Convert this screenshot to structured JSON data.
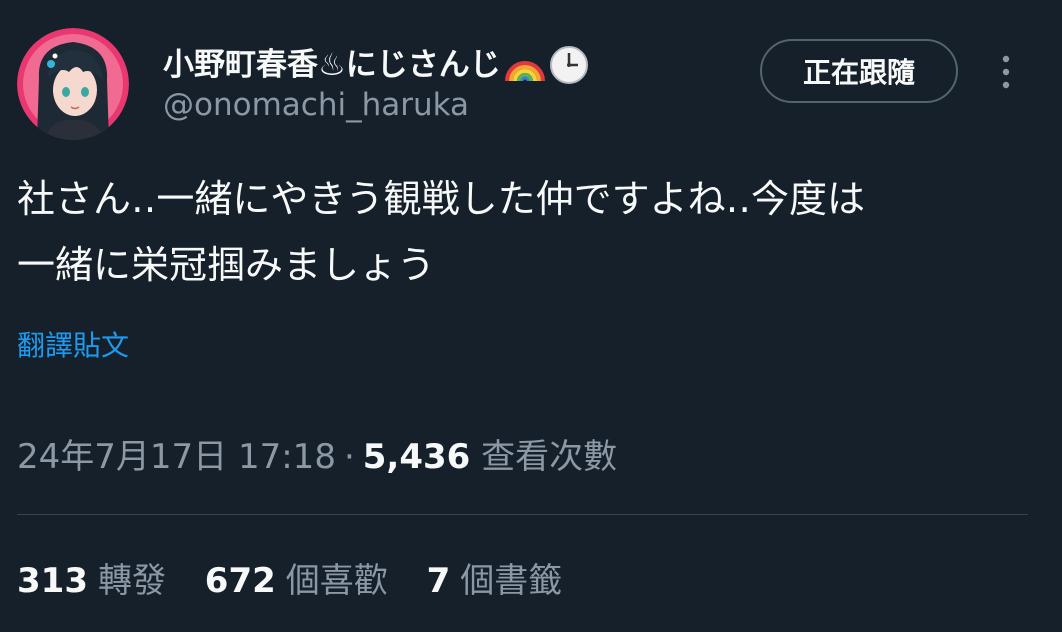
{
  "author": {
    "display_name": "小野町春香♨にじさんじ",
    "handle": "@onomachi_haruka",
    "avatar_icon": "avatar-anime-girl",
    "badge_icons": [
      "rainbow-emoji-icon",
      "clock-emoji-icon"
    ]
  },
  "header": {
    "follow_label": "正在跟隨",
    "more_icon": "more-vertical-icon"
  },
  "tweet": {
    "text_lines": [
      "社さん‥一緒にやきう観戦した仲ですよね‥今度は",
      "一緒に栄冠掴みましょう"
    ],
    "translate_label": "翻譯貼文"
  },
  "meta": {
    "timestamp": "24年7月17日 17:18",
    "separator": "·",
    "views_count": "5,436",
    "views_label": "查看次數"
  },
  "stats": {
    "retweets_count": "313",
    "retweets_label": "轉發",
    "likes_count": "672",
    "likes_label": "個喜歡",
    "bookmarks_count": "7",
    "bookmarks_label": "個書籤"
  },
  "colors": {
    "background": "#15202b",
    "primary_text": "#f7f9f9",
    "secondary_text": "#8b98a5",
    "link": "#1d9bf0",
    "border": "#536471",
    "avatar_bg": "#e8386f"
  }
}
